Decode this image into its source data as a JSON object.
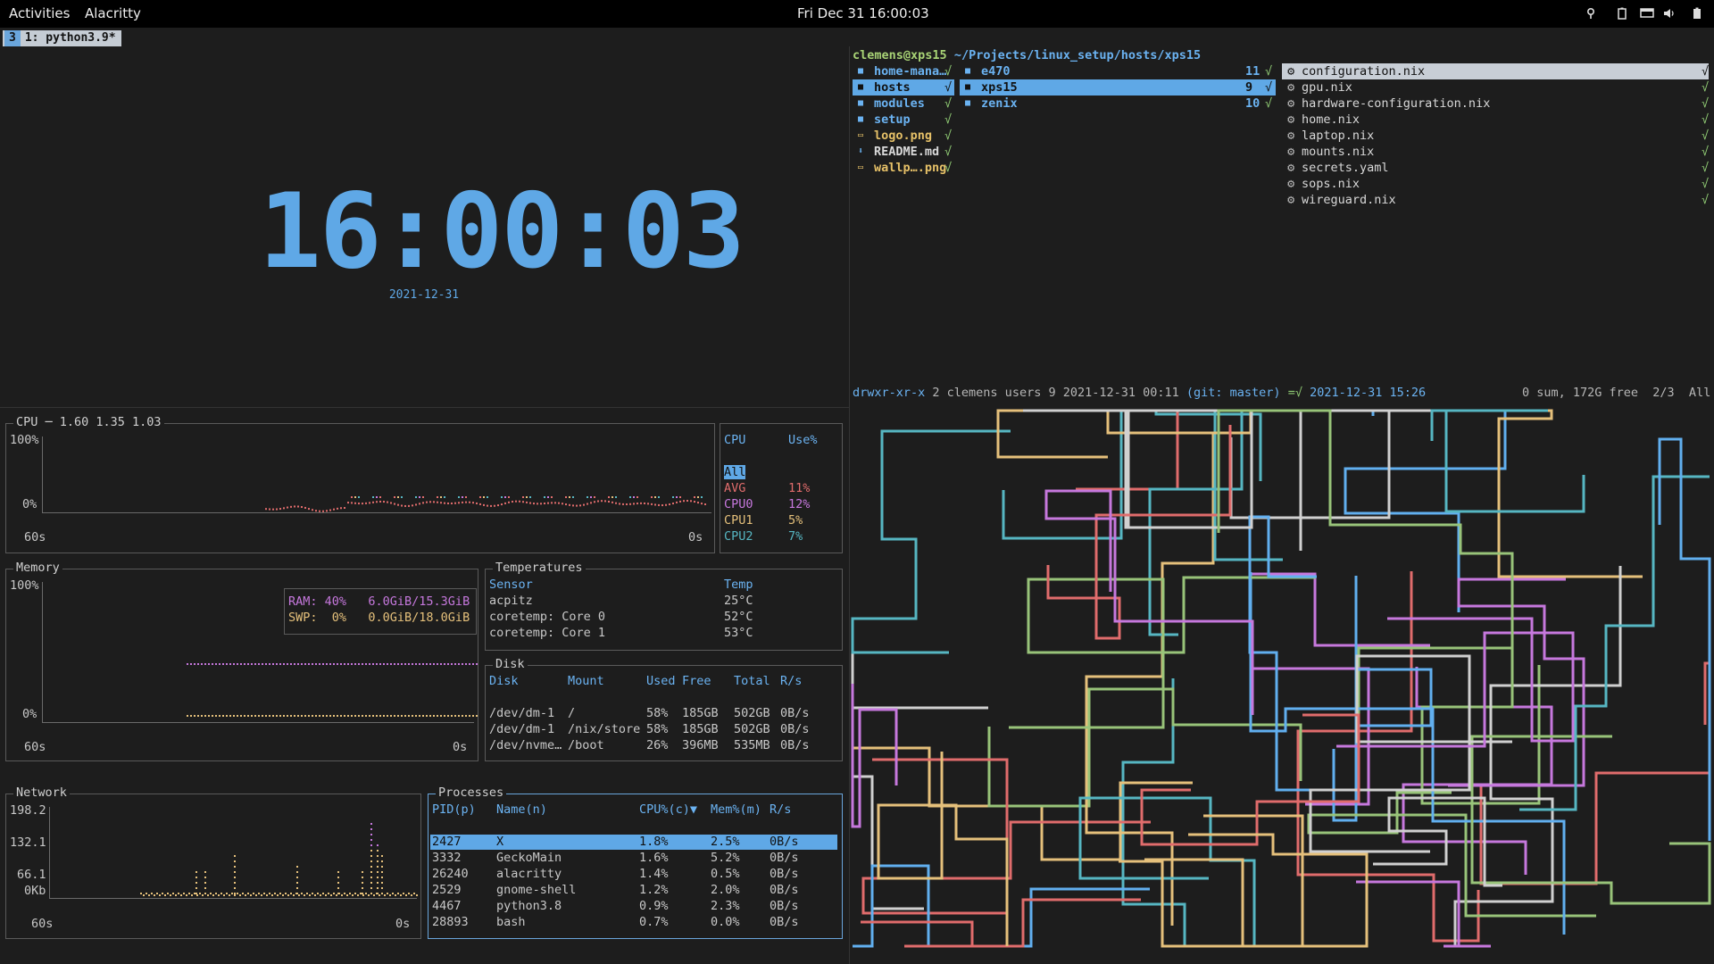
{
  "topbar": {
    "activities": "Activities",
    "app": "Alacritty",
    "datetime": "Fri Dec 31  16:00:03"
  },
  "tray_icons": [
    "location-icon",
    "battery-icon",
    "display-icon",
    "volume-icon",
    "power-icon"
  ],
  "workspace": {
    "number": "3",
    "label": "1: python3.9*"
  },
  "clock": {
    "time": "16:00:03",
    "date": "2021-12-31",
    "color": "#5fa8e6"
  },
  "file_manager": {
    "header_user": "clemens@xps15",
    "header_path": "~/Projects/linux_setup/hosts/xps15",
    "col1": [
      {
        "name": "home-mana…",
        "kind": "dir",
        "flag": "√"
      },
      {
        "name": "hosts",
        "kind": "dir",
        "flag": "√",
        "selected": true
      },
      {
        "name": "modules",
        "kind": "dir",
        "flag": "√"
      },
      {
        "name": "setup",
        "kind": "dir",
        "flag": "√"
      },
      {
        "name": "logo.png",
        "kind": "img",
        "flag": "√"
      },
      {
        "name": "README.md",
        "kind": "doc",
        "flag": "√"
      },
      {
        "name": "wallp….png",
        "kind": "img",
        "flag": "√"
      }
    ],
    "col2": [
      {
        "name": "e470",
        "count": "11",
        "flag": "√"
      },
      {
        "name": "xps15",
        "count": "9",
        "flag": "√",
        "selected": true
      },
      {
        "name": "zenix",
        "count": "10",
        "flag": "√"
      }
    ],
    "col3": [
      {
        "name": "configuration.nix",
        "flag": "√",
        "selected": true
      },
      {
        "name": "gpu.nix",
        "flag": "√"
      },
      {
        "name": "hardware-configuration.nix",
        "flag": "√"
      },
      {
        "name": "home.nix",
        "flag": "√"
      },
      {
        "name": "laptop.nix",
        "flag": "√"
      },
      {
        "name": "mounts.nix",
        "flag": "√"
      },
      {
        "name": "secrets.yaml",
        "flag": "√"
      },
      {
        "name": "sops.nix",
        "flag": "√"
      },
      {
        "name": "wireguard.nix",
        "flag": "√"
      }
    ],
    "status": {
      "perms": "drwxr-xr-x",
      "meta": " 2 clemens users 9 2021-12-31 00:11 ",
      "git": "(git: master)",
      "git_flag": " =√ ",
      "date2": "2021-12-31 15:26",
      "right": "0 sum, 172G free  2/3  All"
    }
  },
  "cpu": {
    "title": "CPU ─ 1.60 1.35 1.03",
    "y_top": "100%",
    "y_bottom": "0%",
    "x_left": "60s",
    "x_right": "0s",
    "table_header": [
      "CPU",
      "Use%"
    ],
    "selected": "All",
    "rows": [
      {
        "name": "AVG",
        "use": "11%",
        "color": "#e06c6c"
      },
      {
        "name": "CPU0",
        "use": "12%",
        "color": "#c678dd"
      },
      {
        "name": "CPU1",
        "use": "5%",
        "color": "#e5c07b"
      },
      {
        "name": "CPU2",
        "use": "7%",
        "color": "#56b6c2"
      }
    ]
  },
  "memory": {
    "title": "Memory",
    "y_top": "100%",
    "y_bottom": "0%",
    "x_left": "60s",
    "x_right": "0s",
    "ram": "RAM: 40%   6.0GiB/15.3GiB",
    "swp": "SWP:  0%   0.0GiB/18.0GiB",
    "ram_percent": 40,
    "swp_percent": 0
  },
  "temperatures": {
    "title": "Temperatures",
    "header": [
      "Sensor",
      "Temp"
    ],
    "rows": [
      [
        "acpitz",
        "25°C"
      ],
      [
        "coretemp: Core 0",
        "52°C"
      ],
      [
        "coretemp: Core 1",
        "53°C"
      ]
    ]
  },
  "disk": {
    "title": "Disk",
    "header": [
      "Disk",
      "Mount",
      "Used",
      "Free",
      "Total",
      "R/s"
    ],
    "rows": [
      [
        "/dev/dm-1",
        "/",
        "58%",
        "185GB",
        "502GB",
        "0B/s"
      ],
      [
        "/dev/dm-1",
        "/nix/store",
        "58%",
        "185GB",
        "502GB",
        "0B/s"
      ],
      [
        "/dev/nvme…",
        "/boot",
        "26%",
        "396MB",
        "535MB",
        "0B/s"
      ]
    ]
  },
  "network": {
    "title": "Network",
    "y_labels": [
      "198.2",
      "132.1",
      "66.1",
      "0Kb"
    ],
    "x_left": "60s",
    "x_right": "0s"
  },
  "processes": {
    "title": "Processes",
    "header": [
      "PID(p)",
      "Name(n)",
      "CPU%(c)▼",
      "Mem%(m)",
      "R/s"
    ],
    "rows": [
      [
        "2427",
        "X",
        "1.8%",
        "2.5%",
        "0B/s"
      ],
      [
        "3332",
        "GeckoMain",
        "1.6%",
        "5.2%",
        "0B/s"
      ],
      [
        "26240",
        "alacritty",
        "1.4%",
        "0.5%",
        "0B/s"
      ],
      [
        "2529",
        "gnome-shell",
        "1.2%",
        "2.0%",
        "0B/s"
      ],
      [
        "4467",
        "python3.8",
        "0.9%",
        "2.3%",
        "0B/s"
      ],
      [
        "28893",
        "bash",
        "0.7%",
        "0.0%",
        "0B/s"
      ]
    ]
  },
  "pipes_colors": [
    "#e06c6c",
    "#c678dd",
    "#56b6c2",
    "#e5c07b",
    "#98c379",
    "#61afef",
    "#d0d0d0"
  ]
}
